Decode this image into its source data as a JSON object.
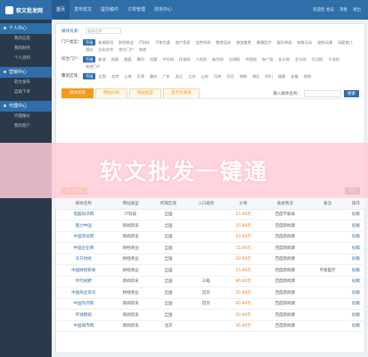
{
  "logo": {
    "text": "软文批发网"
  },
  "topnav": [
    "首页",
    "发布软文",
    "提交稿件",
    "订单管理",
    "财务中心"
  ],
  "topright": [
    "欢迎您 会员",
    "消息",
    "退出"
  ],
  "sidebar": [
    {
      "title": "个人中心",
      "items": [
        "我的信息",
        "我的财务",
        "个人资料"
      ]
    },
    {
      "title": "营销中心",
      "items": [
        "软文发布",
        "自助下单"
      ]
    },
    {
      "title": "代理中心",
      "items": [
        "代理报价",
        "我的客户"
      ]
    }
  ],
  "crumb": {
    "label": "媒体资源：",
    "placeholder": "媒体名称"
  },
  "filters": [
    {
      "label": "门户类型：",
      "chips": [
        "不限",
        "新闻资讯",
        "财经商业",
        "IT科技",
        "汽车交通",
        "房产家居",
        "女性时尚",
        "教育培训",
        "旅游美食",
        "健康医疗",
        "娱乐休闲",
        "体育运动",
        "游戏动漫",
        "母婴育儿",
        "酒店",
        "文化艺术",
        "地方门户",
        "其他"
      ]
    },
    {
      "label": "综合门户：",
      "chips": [
        "不限",
        "新浪",
        "网易",
        "搜狐",
        "腾讯",
        "凤凰",
        "中华网",
        "环球网",
        "人民网",
        "新华网",
        "光明网",
        "中国网",
        "央广网",
        "东方网",
        "北方网",
        "大河网",
        "千龙网",
        "其他门户"
      ]
    },
    {
      "label": "覆盖区域：",
      "chips": [
        "不限",
        "全国",
        "北京",
        "上海",
        "天津",
        "重庆",
        "广东",
        "浙江",
        "江苏",
        "山东",
        "河南",
        "河北",
        "湖南",
        "湖北",
        "四川",
        "福建",
        "安徽",
        "其他"
      ]
    }
  ],
  "tabs": [
    "媒体名称",
    "网站价格",
    "网站类型",
    "是否包收录"
  ],
  "search": {
    "label": "输入媒体名称：",
    "button": "搜索"
  },
  "banner": {
    "text": "软文批发一键通"
  },
  "list": {
    "tab": "媒体列表",
    "export": "导出"
  },
  "table": {
    "headers": [
      "",
      "媒体名称",
      "网站类型",
      "所属区域",
      "入口级别",
      "价格",
      "收录情况",
      "备注",
      "操作"
    ],
    "rows": [
      [
        "",
        "电脑知识网",
        "IT科技",
        "全国",
        "",
        "15.00元",
        "百度不收录",
        "",
        "投稿"
      ],
      [
        "",
        "魅力中国",
        "新闻资讯",
        "全国",
        "",
        "15.00元",
        "百度新闻源",
        "",
        "投稿"
      ],
      [
        "",
        "中国资讯网",
        "新闻资讯",
        "全国",
        "",
        "15.00元",
        "百度新闻源",
        "",
        "投稿"
      ],
      [
        "",
        "中国企业网",
        "财经商业",
        "全国",
        "",
        "15.00元",
        "百度新闻源",
        "",
        "投稿"
      ],
      [
        "",
        "东方财经",
        "财经商业",
        "全国",
        "",
        "20.00元",
        "百度新闻源",
        "",
        "投稿"
      ],
      [
        "",
        "中国财经新闻",
        "财经商业",
        "全国",
        "",
        "15.00元",
        "百度新闻源",
        "不接医疗",
        "投稿"
      ],
      [
        "",
        "时代视野",
        "新闻资讯",
        "全国",
        "三级",
        "60.00元",
        "百度新闻源",
        "",
        "投稿"
      ],
      [
        "",
        "中国商业资讯",
        "财经商业",
        "全国",
        "首页",
        "25.00元",
        "百度新闻源",
        "",
        "投稿"
      ],
      [
        "",
        "中国热点网",
        "新闻资讯",
        "全国",
        "首页",
        "65.00元",
        "百度新闻源",
        "",
        "投稿"
      ],
      [
        "",
        "环球网视",
        "新闻资讯",
        "全国",
        "",
        "55.00元",
        "百度新闻源",
        "",
        "投稿"
      ],
      [
        "",
        "中国城市网",
        "新闻资讯",
        "北京",
        "",
        "35.00元",
        "百度新闻源",
        "",
        "投稿"
      ]
    ]
  }
}
